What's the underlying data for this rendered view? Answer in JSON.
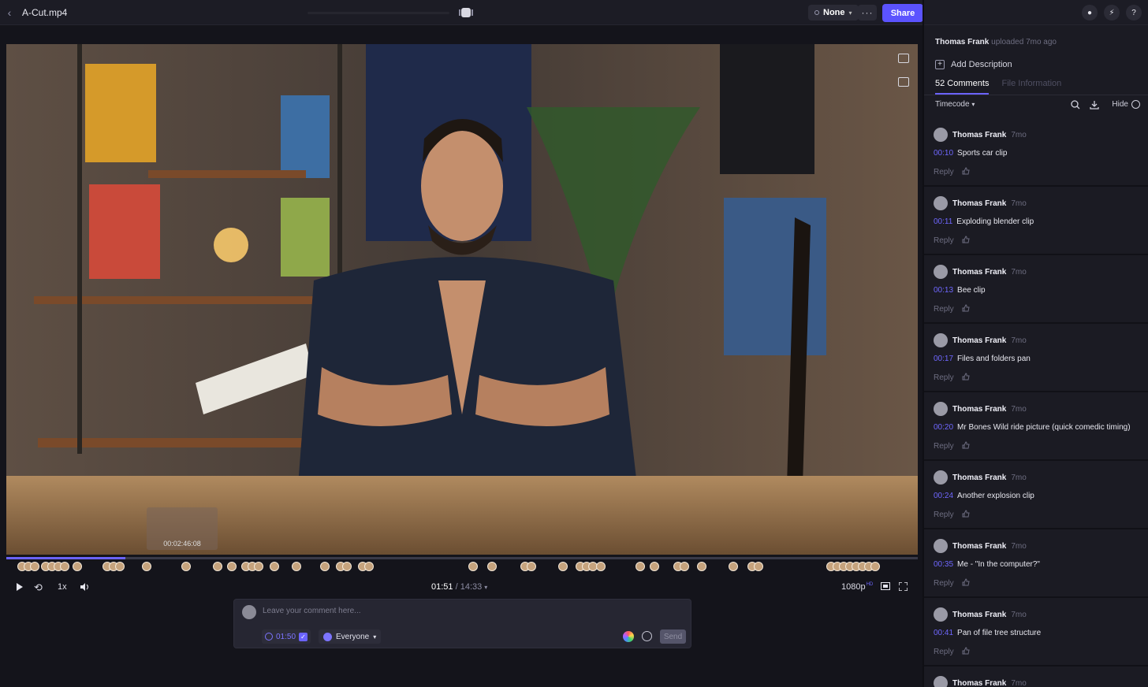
{
  "app": {
    "filename": "A-Cut.mp4",
    "status_label": "None",
    "share_label": "Share",
    "more_label": "···"
  },
  "player": {
    "preview_time": "00:02:46:08",
    "current_time": "01:51",
    "total_time": "14:33",
    "speed": "1x",
    "quality": "1080p",
    "quality_badge": "HD",
    "progress_fraction": 0.131
  },
  "composer": {
    "placeholder": "Leave your comment here...",
    "timecode": "01:50",
    "audience": "Everyone",
    "send_label": "Send"
  },
  "panel": {
    "uploader": "Thomas Frank",
    "uploaded_text": "uploaded 7mo ago",
    "add_description": "Add Description",
    "tabs": [
      "52 Comments",
      "File Information"
    ],
    "sort_label": "Timecode",
    "hide_label": "Hide"
  },
  "comments": [
    {
      "author": "Thomas Frank",
      "age": "7mo",
      "timecode": "00:10",
      "text": "Sports car clip"
    },
    {
      "author": "Thomas Frank",
      "age": "7mo",
      "timecode": "00:11",
      "text": "Exploding blender clip"
    },
    {
      "author": "Thomas Frank",
      "age": "7mo",
      "timecode": "00:13",
      "text": "Bee clip"
    },
    {
      "author": "Thomas Frank",
      "age": "7mo",
      "timecode": "00:17",
      "text": "Files and folders pan"
    },
    {
      "author": "Thomas Frank",
      "age": "7mo",
      "timecode": "00:20",
      "text": "Mr Bones Wild ride picture (quick comedic timing)"
    },
    {
      "author": "Thomas Frank",
      "age": "7mo",
      "timecode": "00:24",
      "text": "Another explosion clip"
    },
    {
      "author": "Thomas Frank",
      "age": "7mo",
      "timecode": "00:35",
      "text": "Me - \"In the computer?\""
    },
    {
      "author": "Thomas Frank",
      "age": "7mo",
      "timecode": "00:41",
      "text": "Pan of file tree structure"
    },
    {
      "author": "Thomas Frank",
      "age": "7mo",
      "timecode": "",
      "text": ""
    }
  ],
  "comment_reply_label": "Reply",
  "colors": {
    "accent": "#5b53ff",
    "timecode": "#6f67ff",
    "bg": "#15151c"
  }
}
